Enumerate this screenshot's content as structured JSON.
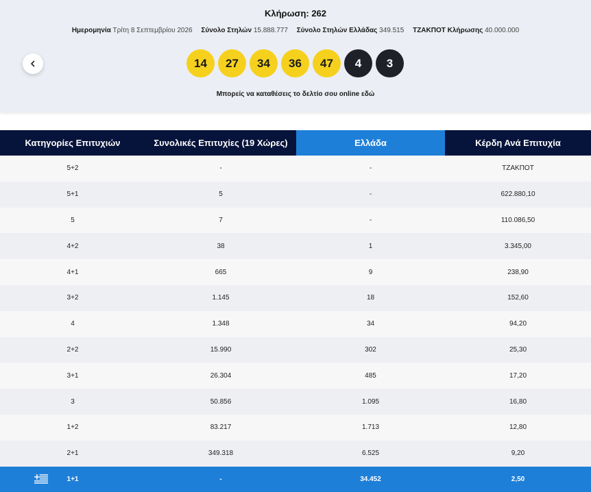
{
  "header": {
    "draw_title": "Κλήρωση: 262",
    "info": [
      {
        "label": "Ημερομηνία",
        "value": "Τρίτη 8 Σεπτεμβρίου 2026"
      },
      {
        "label": "Σύνολο Στηλών",
        "value": "15.888.777"
      },
      {
        "label": "Σύνολο Στηλών Ελλάδας",
        "value": "349.515"
      },
      {
        "label": "ΤΖΑΚΠΟΤ Κλήρωσης",
        "value": "40.000.000"
      }
    ],
    "back_icon": "chevron-left-icon",
    "main_numbers": [
      "14",
      "27",
      "34",
      "36",
      "47"
    ],
    "euro_numbers": [
      "4",
      "3"
    ],
    "online_text": "Μπορείς να καταθέσεις το δελτίο σου online εδώ"
  },
  "colors": {
    "ball_main": "#f5d11e",
    "ball_euro": "#1e2128",
    "table_header": "#06133a",
    "highlight": "#1e7fd8"
  },
  "table": {
    "headers": [
      "Κατηγορίες Επιτυχιών",
      "Συνολικές Επιτυχίες (19 Χώρες)",
      "Ελλάδα",
      "Κέρδη Ανά Επιτυχία"
    ],
    "rows": [
      [
        "5+2",
        "-",
        "-",
        "ΤΖΑΚΠΟΤ"
      ],
      [
        "5+1",
        "5",
        "-",
        "622.880,10"
      ],
      [
        "5",
        "7",
        "-",
        "110.086,50"
      ],
      [
        "4+2",
        "38",
        "1",
        "3.345,00"
      ],
      [
        "4+1",
        "665",
        "9",
        "238,90"
      ],
      [
        "3+2",
        "1.145",
        "18",
        "152,60"
      ],
      [
        "4",
        "1.348",
        "34",
        "94,20"
      ],
      [
        "2+2",
        "15.990",
        "302",
        "25,30"
      ],
      [
        "3+1",
        "26.304",
        "485",
        "17,20"
      ],
      [
        "3",
        "50.856",
        "1.095",
        "16,80"
      ],
      [
        "1+2",
        "83.217",
        "1.713",
        "12,80"
      ],
      [
        "2+1",
        "349.318",
        "6.525",
        "9,20"
      ]
    ],
    "greek_row": {
      "flag_icon": "greek-flag-icon",
      "cells": [
        "1+1",
        "-",
        "34.452",
        "2,50"
      ]
    }
  }
}
